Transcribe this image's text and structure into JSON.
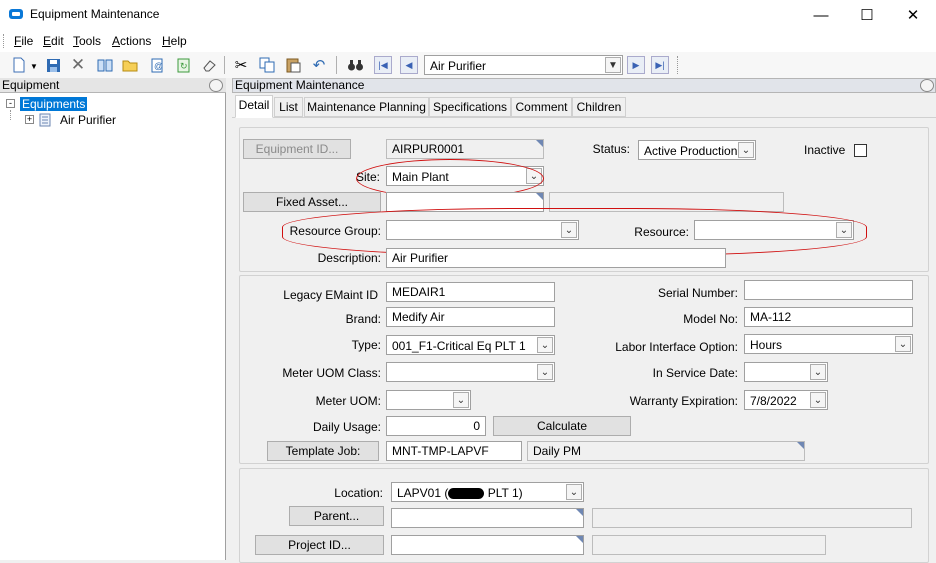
{
  "window": {
    "title": "Equipment Maintenance",
    "minimize": "—",
    "maximize": "☐",
    "close": "✕"
  },
  "menu": [
    {
      "pre": "",
      "u": "F",
      "post": "ile"
    },
    {
      "pre": "",
      "u": "E",
      "post": "dit"
    },
    {
      "pre": "",
      "u": "T",
      "post": "ools"
    },
    {
      "pre": "",
      "u": "A",
      "post": "ctions"
    },
    {
      "pre": "",
      "u": "H",
      "post": "elp"
    }
  ],
  "toolbar": {
    "record_combo": "Air Purifier"
  },
  "left": {
    "header": "Equipment",
    "root": "Equipments",
    "child": "Air Purifier"
  },
  "right": {
    "header": "Equipment Maintenance"
  },
  "tabs": [
    "Detail",
    "List",
    "Maintenance Planning",
    "Specifications",
    "Comment",
    "Children"
  ],
  "g1": {
    "equipment_id_btn": "Equipment ID...",
    "equipment_id": "AIRPUR0001",
    "status_label": "Status:",
    "status": "Active Production",
    "inactive_label": "Inactive",
    "site_label": "Site:",
    "site": "Main Plant",
    "fixed_asset_btn": "Fixed Asset...",
    "fixed_asset": "",
    "fixed_asset_desc": "",
    "resource_group_label": "Resource Group:",
    "resource_group": "",
    "resource_label": "Resource:",
    "resource": "",
    "description_label": "Description:",
    "description": "Air Purifier"
  },
  "g2": {
    "legacy_label": "Legacy EMaint ID",
    "legacy": "MEDAIR1",
    "serial_label": "Serial Number:",
    "serial": "",
    "brand_label": "Brand:",
    "brand": "Medify Air",
    "model_label": "Model No:",
    "model": "MA-112",
    "type_label": "Type:",
    "type": "001_F1-Critical Eq PLT 1",
    "labor_label": "Labor Interface Option:",
    "labor": "Hours",
    "meter_class_label": "Meter UOM Class:",
    "meter_class": "",
    "service_date_label": "In Service Date:",
    "service_date": "",
    "meter_uom_label": "Meter UOM:",
    "meter_uom": "",
    "warranty_label": "Warranty Expiration:",
    "warranty": "7/8/2022",
    "daily_usage_label": "Daily Usage:",
    "daily_usage": "0",
    "calculate_btn": "Calculate",
    "template_btn": "Template Job:",
    "template_job": "MNT-TMP-LAPVF",
    "template_desc": "Daily PM"
  },
  "g3": {
    "location_label": "Location:",
    "location_pre": "LAPV01 (",
    "location_post": " PLT 1)",
    "parent_btn": "Parent...",
    "parent": "",
    "parent_desc": "",
    "project_btn": "Project ID...",
    "project": "",
    "project_desc": ""
  }
}
